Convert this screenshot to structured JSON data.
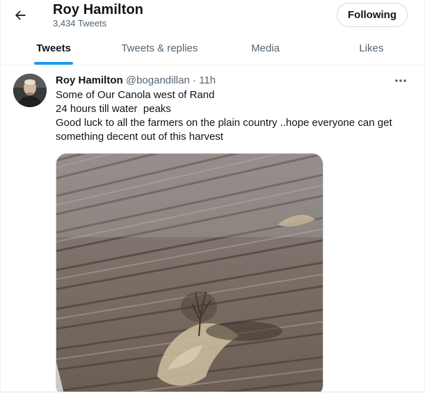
{
  "header": {
    "title": "Roy Hamilton",
    "subtitle": "3,434 Tweets",
    "back_icon": "arrow-left-icon",
    "follow_label": "Following"
  },
  "tabs": [
    {
      "label": "Tweets",
      "active": true
    },
    {
      "label": "Tweets & replies",
      "active": false
    },
    {
      "label": "Media",
      "active": false
    },
    {
      "label": "Likes",
      "active": false
    }
  ],
  "tweet": {
    "author_name": "Roy Hamilton",
    "handle": "@bogandillan",
    "separator": "·",
    "time": "11h",
    "more_icon": "more-horizontal-icon",
    "lines": [
      "Some of Our Canola west of Rand",
      "24 hours till water  peaks",
      "Good luck to all the farmers on the plain country ..hope everyone can get",
      "something decent out of this harvest"
    ]
  },
  "colors": {
    "accent": "#1d9bf0",
    "text_primary": "#0f1419",
    "text_secondary": "#536471",
    "border": "#eff3f4"
  }
}
